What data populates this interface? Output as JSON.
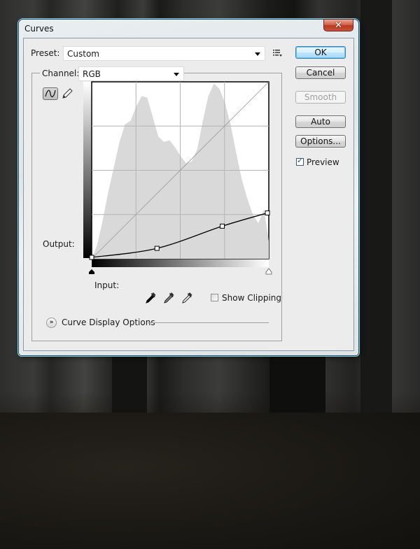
{
  "window": {
    "title": "Curves",
    "close_glyph": "✕"
  },
  "preset": {
    "label": "Preset:",
    "value": "Custom",
    "menu_icon": "list-menu-icon"
  },
  "channel": {
    "label": "Channel:",
    "value": "RGB"
  },
  "tools": {
    "curve_tool": "curve-point-tool",
    "pencil_tool": "pencil-tool"
  },
  "graph": {
    "output_label": "Output:",
    "input_label": "Input:",
    "grid_divisions": 4
  },
  "eyedroppers": [
    "black-point-eyedropper",
    "gray-point-eyedropper",
    "white-point-eyedropper"
  ],
  "show_clipping": {
    "label": "Show Clipping",
    "checked": false
  },
  "curve_display_options": {
    "label": "Curve Display Options"
  },
  "buttons": {
    "ok": "OK",
    "cancel": "Cancel",
    "smooth": "Smooth",
    "auto": "Auto",
    "options": "Options..."
  },
  "preview": {
    "label": "Preview",
    "checked": true
  },
  "chart_data": {
    "type": "line",
    "title": "",
    "xlabel": "Input",
    "ylabel": "Output",
    "xlim": [
      0,
      255
    ],
    "ylim": [
      0,
      255
    ],
    "grid": true,
    "series": [
      {
        "name": "RGB curve",
        "points": [
          [
            0,
            2
          ],
          [
            94,
            15
          ],
          [
            188,
            47
          ],
          [
            253,
            66
          ]
        ]
      },
      {
        "name": "baseline",
        "points": [
          [
            0,
            0
          ],
          [
            255,
            255
          ]
        ]
      }
    ],
    "histogram": {
      "x": [
        0,
        8,
        16,
        24,
        32,
        40,
        48,
        56,
        64,
        72,
        80,
        88,
        96,
        104,
        112,
        120,
        128,
        136,
        144,
        152,
        160,
        168,
        176,
        184,
        192,
        200,
        208,
        216,
        224,
        232,
        240,
        248,
        255
      ],
      "relative_height": [
        0,
        8,
        22,
        38,
        52,
        66,
        76,
        78,
        86,
        92,
        91,
        80,
        69,
        66,
        67,
        63,
        58,
        54,
        55,
        62,
        78,
        92,
        99,
        96,
        88,
        76,
        60,
        45,
        34,
        25,
        20,
        28,
        10
      ]
    }
  }
}
